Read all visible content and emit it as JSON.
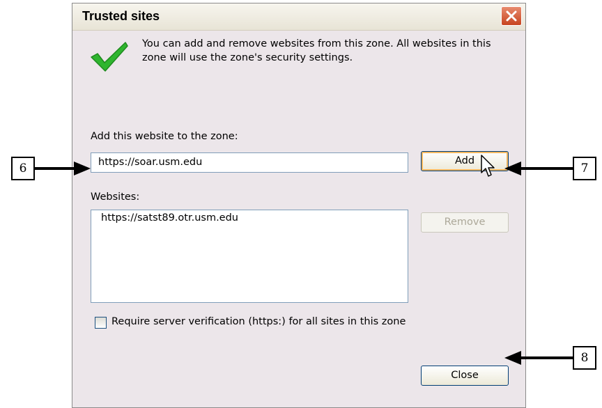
{
  "window": {
    "title": "Trusted sites"
  },
  "info_text": "You can add and remove websites from this zone. All websites in this zone will use the zone's security settings.",
  "add_section": {
    "label": "Add this website to the zone:",
    "input_value": "https://soar.usm.edu",
    "add_button": "Add"
  },
  "websites_section": {
    "label": "Websites:",
    "items": [
      "https://satst89.otr.usm.edu"
    ],
    "remove_button": "Remove"
  },
  "require_verification": {
    "label": "Require server verification (https:) for all sites in this zone",
    "checked": false
  },
  "close_button": "Close",
  "callouts": [
    "6",
    "7",
    "8"
  ],
  "colors": {
    "dialog_bg": "#ece6ea",
    "close_red": "#c7441e",
    "check_green": "#2fb52f",
    "focus_orange": "#f5b860"
  }
}
